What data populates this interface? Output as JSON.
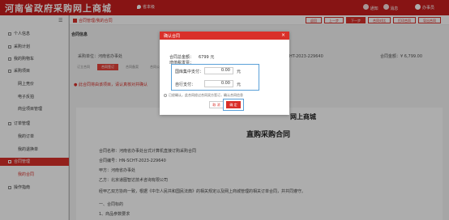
{
  "header": {
    "site_title": "河南省政府采购网上商城",
    "location": "省本级",
    "icons": [
      "bell-icon",
      "message-icon"
    ],
    "icon_labels": [
      "通知",
      "消息"
    ],
    "user_name": "办事员"
  },
  "sidebar": {
    "items": [
      {
        "label": "个人信息",
        "icon": "user-icon"
      },
      {
        "label": "采购计划",
        "icon": "plan-icon"
      },
      {
        "label": "我的购物车",
        "icon": "cart-icon"
      },
      {
        "label": "采购项目",
        "icon": "project-icon"
      },
      {
        "label": "网上竞价",
        "sub": true
      },
      {
        "label": "电子反拍",
        "sub": true
      },
      {
        "label": "商业项目管理",
        "sub": true
      },
      {
        "label": "订单管理",
        "icon": "order-icon"
      },
      {
        "label": "我的订单",
        "sub": true
      },
      {
        "label": "我的退换单",
        "sub": true
      },
      {
        "label": "合同管理",
        "icon": "contract-icon",
        "active": true
      },
      {
        "label": "我的合同",
        "sub": true,
        "sub_active": true
      },
      {
        "label": "操作指南",
        "icon": "guide-icon"
      }
    ]
  },
  "content": {
    "breadcrumb": "合同管理/我的合同",
    "buttons": [
      "返回",
      "上一步",
      "下一步",
      "合同对比",
      "打印合同",
      "导出合同"
    ],
    "section_title": "合同信息",
    "buyer_label": "采购单位：河南省办事处",
    "contract_no": "合同编号：HN-SCHT-2023-229640",
    "amount": "合同金额：¥ 6,799.00",
    "steps": [
      "订立合同",
      "合同签订",
      "合同备案",
      "合同公示",
      "已完成"
    ],
    "warning": "● 此合同将由该项目，请认真核对并确认",
    "doc_shop": "网上商城",
    "doc_title": "直购采购合同",
    "doc_lines": [
      "合同名称：河南省办事处台式计算机直接订购采购合同",
      "合同编号：HN-SCHT-2023-229640",
      "甲方：河南省办事处",
      "乙方：北京递图智达技术咨询有限公司",
      "经甲乙双方协商一致，根据《中华人民共和国民法典》的相关规定以及网上商城管理的相关订单合同，并共同遵守。",
      "一、合同标的",
      "1、商品参数要求"
    ]
  },
  "modal": {
    "title": "确认合同",
    "close": "×",
    "total_label": "合同总金额：",
    "total_value": "6799 元",
    "tax_label": "增值税发票：",
    "pay_rows": [
      {
        "label": "国库集中支付：",
        "value": "0.00",
        "unit": "元"
      },
      {
        "label": "自行支付：",
        "value": "0.00",
        "unit": "元"
      }
    ],
    "radio_text": "已经确认，此合同经过合同双方签订，确认合同信息",
    "cancel_label": "取 消",
    "confirm_label": "确 定"
  }
}
